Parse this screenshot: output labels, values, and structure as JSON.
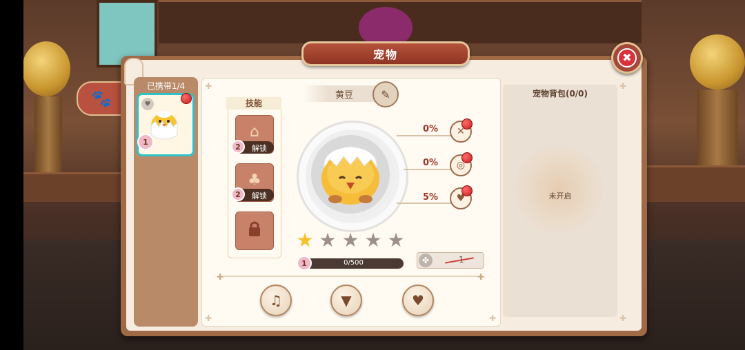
{
  "title": "宠物",
  "close_label": "✖",
  "side_tab": {
    "icon": "paw-icon",
    "glyph": "🐾"
  },
  "pet_list": {
    "header": "已携带1/4",
    "slot": {
      "level": "1"
    }
  },
  "skills": {
    "title": "技能",
    "slots": [
      {
        "level": "2",
        "label": "解锁",
        "icon": "bag-icon"
      },
      {
        "level": "2",
        "label": "解锁",
        "icon": "pouch-icon"
      },
      {
        "icon": "lock-icon"
      }
    ]
  },
  "pet": {
    "name": "黄豆",
    "stars_filled": 1,
    "stars_total": 5,
    "level": "1",
    "exp": "0/500",
    "item_count": "1"
  },
  "stats": [
    {
      "value": "0%",
      "icon": "food-icon"
    },
    {
      "value": "0%",
      "icon": "donut-icon"
    },
    {
      "value": "5%",
      "icon": "heart-icon"
    }
  ],
  "bottom_buttons": [
    {
      "icon": "bell-icon"
    },
    {
      "icon": "shirt-icon"
    },
    {
      "icon": "heart-icon"
    }
  ],
  "backpack": {
    "title": "宠物背包(0/0)",
    "status": "未开启"
  }
}
